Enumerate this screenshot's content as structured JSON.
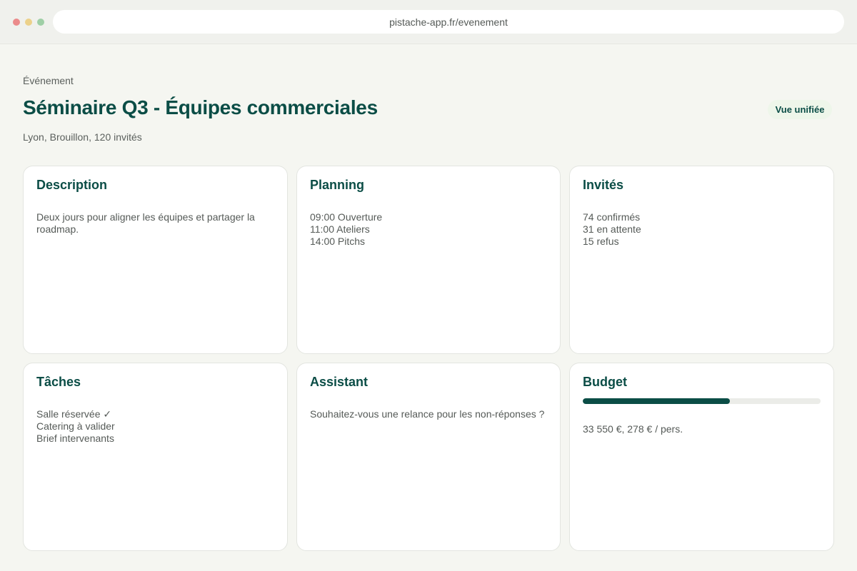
{
  "colors": {
    "accent": "#0b4d46",
    "badge_bg": "#eef6ea",
    "dot_red": "#eb8b8b",
    "dot_yellow": "#ecd18a",
    "dot_green": "#9fcfa6"
  },
  "browser": {
    "url": "pistache-app.fr/evenement"
  },
  "header": {
    "eyebrow": "Événement",
    "title": "Séminaire Q3 - Équipes commerciales",
    "subtitle": "Lyon, Brouillon, 120 invités",
    "badge": "Vue unifiée"
  },
  "cards": {
    "description": {
      "title": "Description",
      "body": "Deux jours pour aligner les équipes et partager la roadmap."
    },
    "planning": {
      "title": "Planning",
      "lines": [
        "09:00 Ouverture",
        "11:00 Ateliers",
        "14:00 Pitchs"
      ]
    },
    "invites": {
      "title": "Invités",
      "lines": [
        "74 confirmés",
        "31 en attente",
        "15 refus"
      ]
    },
    "taches": {
      "title": "Tâches",
      "lines": [
        "Salle réservée ✓",
        "Catering à valider",
        "Brief intervenants"
      ]
    },
    "assistant": {
      "title": "Assistant",
      "body": "Souhaitez-vous une relance pour les non-réponses ?"
    },
    "budget": {
      "title": "Budget",
      "progress_fraction": 0.62,
      "text": "33 550 €, 278 € / pers."
    }
  }
}
